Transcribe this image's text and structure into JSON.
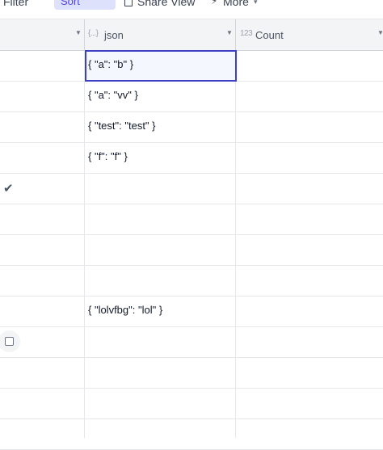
{
  "toolbar": {
    "filter_label": "Filter",
    "sort_label": "Sort",
    "share_label": "Share View",
    "more_label": "More"
  },
  "columns": [
    {
      "name": "",
      "type_icon": ""
    },
    {
      "name": "json",
      "type_icon": "{...}"
    },
    {
      "name": "Count",
      "type_icon": "123"
    }
  ],
  "rows": [
    {
      "check": "",
      "json": "{ \"a\": \"b\" }",
      "count": "",
      "selected": true
    },
    {
      "check": "",
      "json": "{ \"a\": \"vv\" }",
      "count": ""
    },
    {
      "check": "",
      "json": "{ \"test\": \"test\" }",
      "count": ""
    },
    {
      "check": "",
      "json": "{ \"f\": \"f\" }",
      "count": ""
    },
    {
      "check": "checked",
      "json": "",
      "count": ""
    },
    {
      "check": "",
      "json": "",
      "count": ""
    },
    {
      "check": "",
      "json": "",
      "count": ""
    },
    {
      "check": "",
      "json": "",
      "count": ""
    },
    {
      "check": "",
      "json": "{ \"lolvfbg\": \"lol\" }",
      "count": ""
    },
    {
      "check": "unchecked",
      "json": "",
      "count": ""
    },
    {
      "check": "",
      "json": "",
      "count": ""
    },
    {
      "check": "",
      "json": "",
      "count": ""
    },
    {
      "check": "",
      "json": "",
      "count": ""
    }
  ]
}
